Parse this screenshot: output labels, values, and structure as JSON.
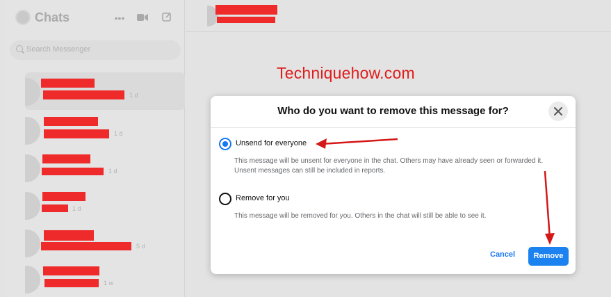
{
  "sidebar": {
    "title": "Chats",
    "search_placeholder": "Search Messenger",
    "conversations": [
      {
        "time": "1 d",
        "active": true
      },
      {
        "time": "1 d"
      },
      {
        "time": "1 d"
      },
      {
        "time": "1 d"
      },
      {
        "time": "5 d"
      },
      {
        "time": "1 w"
      }
    ]
  },
  "watermark": "Techniquehow.com",
  "dialog": {
    "title": "Who do you want to remove this message for?",
    "options": [
      {
        "label": "Unsend for everyone",
        "selected": true,
        "description": "This message will be unsent for everyone in the chat. Others may have already seen or forwarded it. Unsent messages can still be included in reports."
      },
      {
        "label": "Remove for you",
        "selected": false,
        "description": "This message will be removed for you. Others in the chat will still be able to see it."
      }
    ],
    "cancel_label": "Cancel",
    "remove_label": "Remove"
  },
  "colors": {
    "accent": "#1877f2",
    "redaction": "#ee2a2a",
    "annotation": "#d41818"
  }
}
